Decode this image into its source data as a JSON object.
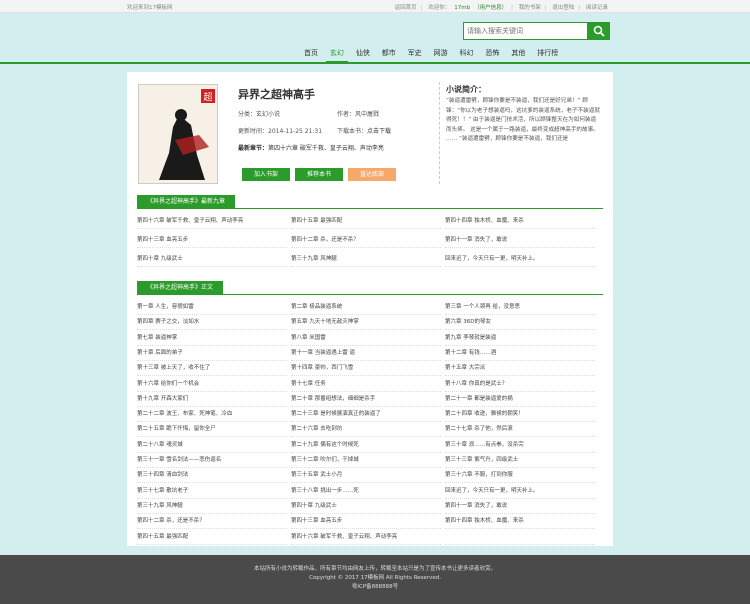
{
  "topbar": {
    "welcome": "欢迎来到17模板网",
    "links": [
      "返回首页",
      "欢迎你：",
      "17mb",
      "（用户信息）",
      "我的书架",
      "退出登陆",
      "阅读记录"
    ]
  },
  "search": {
    "placeholder": "请输入搜索关键词"
  },
  "nav": [
    "首页",
    "玄幻",
    "仙侠",
    "都市",
    "军史",
    "网游",
    "科幻",
    "恐怖",
    "其他",
    "排行榜"
  ],
  "book": {
    "title": "异界之超神高手",
    "category": "分类：玄幻小说",
    "author": "作者：风中屠戮",
    "updated": "更新时间：2014-11-25 21:31",
    "download_label": "下载本书：",
    "download_link": "点击下载",
    "latest_label": "最新章节：",
    "latest_chapter": "第四十六章 破军千救、皇子云翔、声动李亮",
    "buttons": [
      "加入书架",
      "推荐本书",
      "直达底部"
    ],
    "cover_badge": "超",
    "cover_title": "异界之超神高手"
  },
  "intro": {
    "title": "小说简介：",
    "text": "“装逼遭雷劈，顾锋你要是不装逼，我们还是好兄弟！” 顾锋：“你以为老子想装逼吗，这坑爹的装逼系统，老子不装逼就得死！！” 由于装逼是门技术活，所以顾锋整天在为如何装逼而头疼。 这是一个属于一路装逼，最终变成超神高手的故事。 …… “装逼遭雷劈，顾锋你要是不装逼，我们还是"
  },
  "latest_section": {
    "title": "《异界之超神高手》最新九章",
    "chapters": [
      "第四十六章 破军千救、皇子云翔、声动李亮",
      "第四十五章 最强匹配",
      "第四十四章 独木桥、血魔、来杀",
      "第四十三章 血亮五步",
      "第四十二章 杀，还是不杀？",
      "第四十一章 消失了，敢说",
      "第四十章 九级武士",
      "第三十九章 风神腿",
      "回来迟了，今天只有一更，明天补上。"
    ]
  },
  "all_section": {
    "title": "《异界之超神高手》正文",
    "chapters": [
      "第一章 人生，容貌如雷",
      "第二章 极品装逼系统",
      "第三章 一个人颈再 给，没意思",
      "第四章 赛子之交，淡如水",
      "第五章 九天十地无敌灭神掌",
      "第六章 36D的琴女",
      "第七章 装逼神掌",
      "第八章 米国雷",
      "第九章 李琴就是装逼",
      "第十章 后面的弟子",
      "第十一章 当装逼遇上雷 逼",
      "第十二章 有钱……酒",
      "第十三章 被上天了，收不住了",
      "第十四章 豪帅，西门飞雪",
      "第十五章 大宗派",
      "第十六章 给你们一个机会",
      "第十七章 任务",
      "第十八章 你真的是武士？",
      "第十九章 开森大家们",
      "第二十章 那番组想法，细细是杀手",
      "第二十一章 都是装逼爱的祸",
      "第二十二章 波王、布家、死神笔、冷血",
      "第二十三章 是时候展演真正的装逼了",
      "第二十四章 收逊，雅候的朝笑！",
      "第二十五章 跪下仟悔，留你全尸",
      "第二十六章 去吃刻坊",
      "第二十七章 杀了他，然后滚",
      "第二十八章 魂灵城",
      "第二十九章 偶有这个时候死",
      "第三十章 浪……有点拳，没杀完",
      "第三十一章 雪名剑法——悲伤逼名",
      "第三十二章 吹尔们，干掉城",
      "第三十三章 紫气升，四级武士",
      "第三十四章 清血剑法",
      "第三十五章 武士小月",
      "第三十六章 不服，打到你服",
      "第三十七章 散坑老子",
      "第三十八章 挑出一步……死",
      "回来迟了，今天只有一更，明天补上。",
      "第三十九章 风神腿",
      "第四十章 九级武士",
      "第四十一章 消失了，敢说",
      "第四十二章 杀，还是不杀？",
      "第四十三章 血亮五步",
      "第四十四章 独木桥、血魔、来杀",
      "第四十五章 最强匹配",
      "第四十六章 破军千救、皇子云翔、声动李亮",
      ""
    ]
  },
  "footer": {
    "line1": "本站所有小说为转载作品，所有章节均由网友上传，转载至本站只是为了宣传本书让更多读者欣赏。",
    "line2": "Copyright © 2017 17模板网 All Rights Reserved.",
    "line3": "粤ICP备888888号"
  },
  "colors": {
    "accent": "#2b9b2b",
    "page_bg": "#d3eeee",
    "footer_bg": "#4a4a4a",
    "orange": "#f5a96b"
  }
}
